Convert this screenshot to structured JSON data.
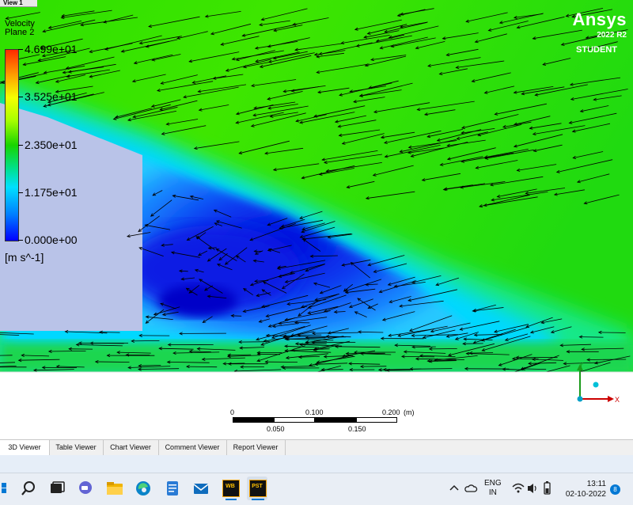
{
  "window": {
    "view_tab": "View 1"
  },
  "legend": {
    "title_line1": "Velocity",
    "title_line2": "Plane 2",
    "ticks": [
      "4.699e+01",
      "3.525e+01",
      "2.350e+01",
      "1.175e+01",
      "0.000e+00"
    ],
    "units": "[m s^-1]",
    "range": [
      0.0,
      46.99
    ]
  },
  "branding": {
    "name": "Ansys",
    "version": "2022 R2",
    "edition": "STUDENT"
  },
  "scale_bar": {
    "top_labels": [
      "0",
      "0.100",
      "0.200"
    ],
    "unit": "(m)",
    "bottom_labels": [
      "0.050",
      "0.150"
    ]
  },
  "triad": {
    "y": "Y",
    "x": "X"
  },
  "viewer_tabs": [
    "3D Viewer",
    "Table Viewer",
    "Chart Viewer",
    "Comment Viewer",
    "Report Viewer"
  ],
  "active_viewer_tab": "3D Viewer",
  "taskbar": {
    "apps": [
      "start-icon",
      "search-icon",
      "task-view-icon",
      "chat-icon",
      "file-explorer-icon",
      "edge-icon",
      "notepad-icon",
      "mail-icon",
      "workbench-icon",
      "cfd-post-icon"
    ],
    "workbench_label": "WB",
    "post_label": "PST",
    "language_line1": "ENG",
    "language_line2": "IN",
    "time": "13:11",
    "date": "02-10-2022",
    "notifications": "8"
  },
  "colors": {
    "accent": "#0078d4",
    "field_high": "#ff2a00",
    "field_mid": "#18d400",
    "field_low": "#0000ff",
    "obstacle": "#b9c3e8"
  }
}
